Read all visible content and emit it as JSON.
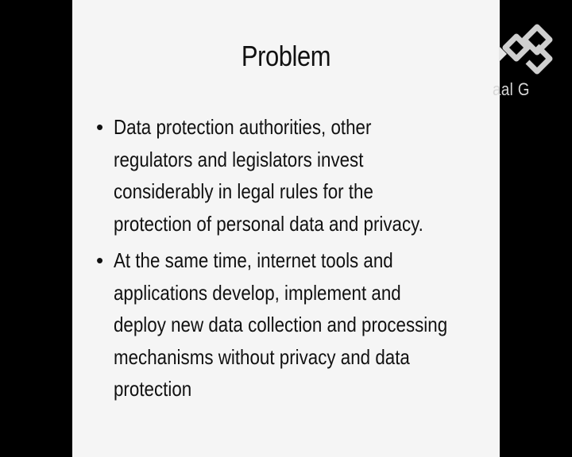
{
  "slide": {
    "title": "Problem",
    "bullets": [
      "Data protection authorities, other regulators and legislators invest considerably in legal rules for the protection of personal data and privacy.",
      "At the same time, internet tools and applications develop, implement and deploy new data collection and processing mechanisms without privacy and data protection"
    ]
  },
  "overlay": {
    "channel_name": "aal G",
    "logo_icon": "channel-logo-icon",
    "colors": {
      "background": "#000000",
      "slide": "#f5f5f5",
      "text": "#111111",
      "logo": "#cfcfcf"
    }
  }
}
